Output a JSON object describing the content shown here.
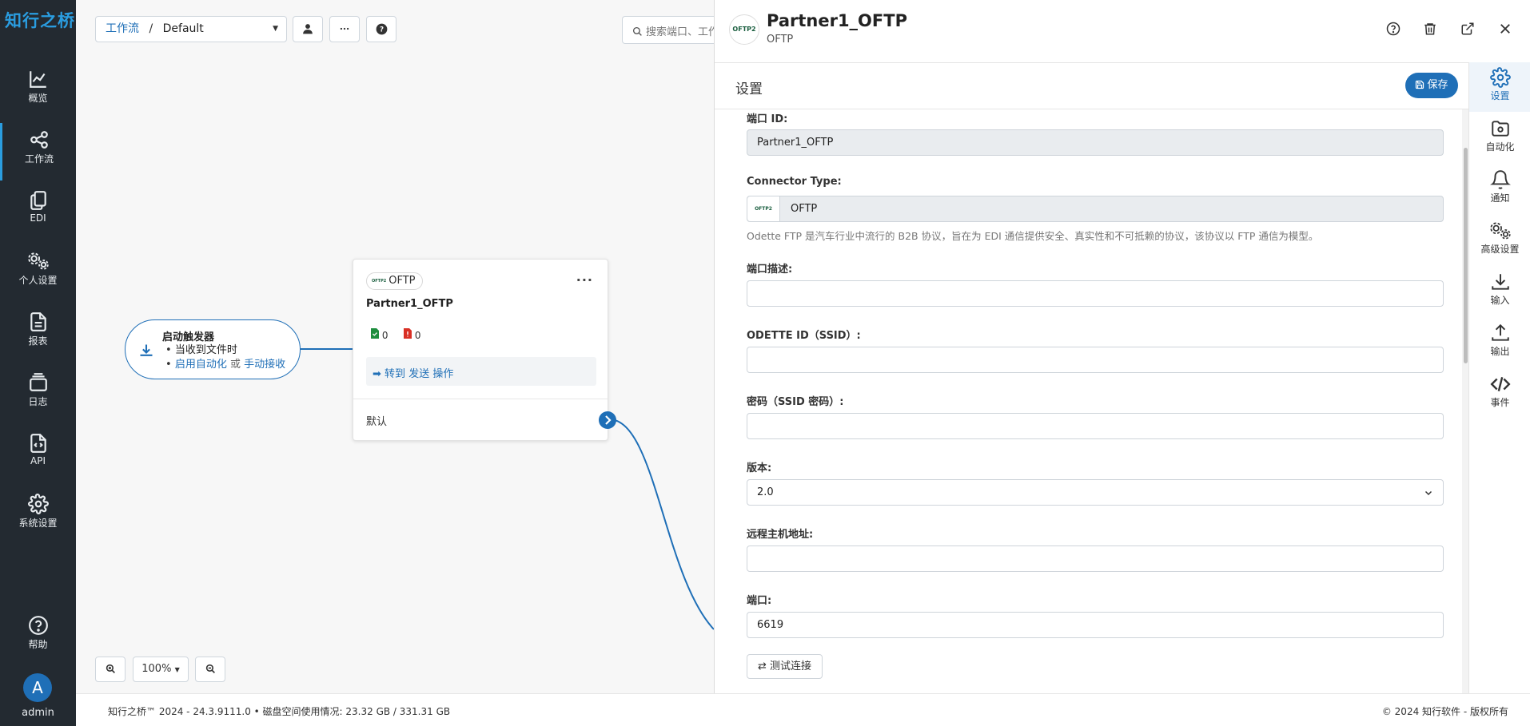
{
  "app": {
    "logo": "知行之桥"
  },
  "nav": [
    {
      "label": "概览",
      "icon": "chart-line-icon"
    },
    {
      "label": "工作流",
      "icon": "workflow-icon",
      "active": true
    },
    {
      "label": "EDI",
      "icon": "documents-icon"
    },
    {
      "label": "个人设置",
      "icon": "gears-icon"
    },
    {
      "label": "报表",
      "icon": "report-icon"
    },
    {
      "label": "日志",
      "icon": "log-icon"
    },
    {
      "label": "API",
      "icon": "api-file-icon"
    },
    {
      "label": "系统设置",
      "icon": "gear-icon"
    },
    {
      "label": "帮助",
      "icon": "help-icon"
    }
  ],
  "user": {
    "initial": "A",
    "name": "admin"
  },
  "toolbar": {
    "breadcrumb_link": "工作流",
    "breadcrumb_sep": "/",
    "workspace": "Default",
    "search_placeholder": "搜索端口、工作流..."
  },
  "trigger": {
    "title": "启动触发器",
    "item1": "当收到文件时",
    "enable_automation": "启用自动化",
    "or": "或",
    "manual_receive": "手动接收"
  },
  "node": {
    "chip": "OFTP",
    "chip_logo": "OFTP2",
    "title": "Partner1_OFTP",
    "success_count": "0",
    "error_count": "0",
    "goto_prefix": "转到",
    "goto_send": "发送",
    "goto_ops": "操作",
    "default_label": "默认"
  },
  "zoom": {
    "level": "100%"
  },
  "footer": {
    "left": "知行之桥™ 2024 - 24.3.9111.0  •  磁盘空间使用情况:  23.32 GB / 331.31 GB",
    "right": "© 2024 知行软件 - 版权所有"
  },
  "panel": {
    "logo": "OFTP2",
    "title": "Partner1_OFTP",
    "subtitle": "OFTP",
    "section": "设置",
    "save_label": "保存",
    "fields": {
      "port_id_label": "端口 ID:",
      "port_id_value": "Partner1_OFTP",
      "connector_label": "Connector Type:",
      "connector_logo": "OFTP2",
      "connector_value": "OFTP",
      "connector_help": "Odette FTP 是汽车行业中流行的 B2B 协议，旨在为 EDI 通信提供安全、真实性和不可抵赖的协议，该协议以 FTP 通信为模型。",
      "desc_label": "端口描述:",
      "desc_value": "",
      "ssid_label": "ODETTE ID（SSID）:",
      "ssid_value": "",
      "pwd_label": "密码（SSID 密码）:",
      "pwd_value": "",
      "version_label": "版本:",
      "version_value": "2.0",
      "host_label": "远程主机地址:",
      "host_value": "",
      "port_label": "端口:",
      "port_value": "6619",
      "test_label": "测试连接"
    },
    "tabs": [
      {
        "label": "设置",
        "icon": "gear-icon",
        "active": true
      },
      {
        "label": "自动化",
        "icon": "folder-gear-icon"
      },
      {
        "label": "通知",
        "icon": "bell-icon"
      },
      {
        "label": "高级设置",
        "icon": "gears-icon"
      },
      {
        "label": "输入",
        "icon": "download-icon"
      },
      {
        "label": "输出",
        "icon": "upload-icon"
      },
      {
        "label": "事件",
        "icon": "code-icon"
      }
    ]
  },
  "colors": {
    "accent": "#1f6fb7",
    "nav_bg": "#232a31"
  }
}
